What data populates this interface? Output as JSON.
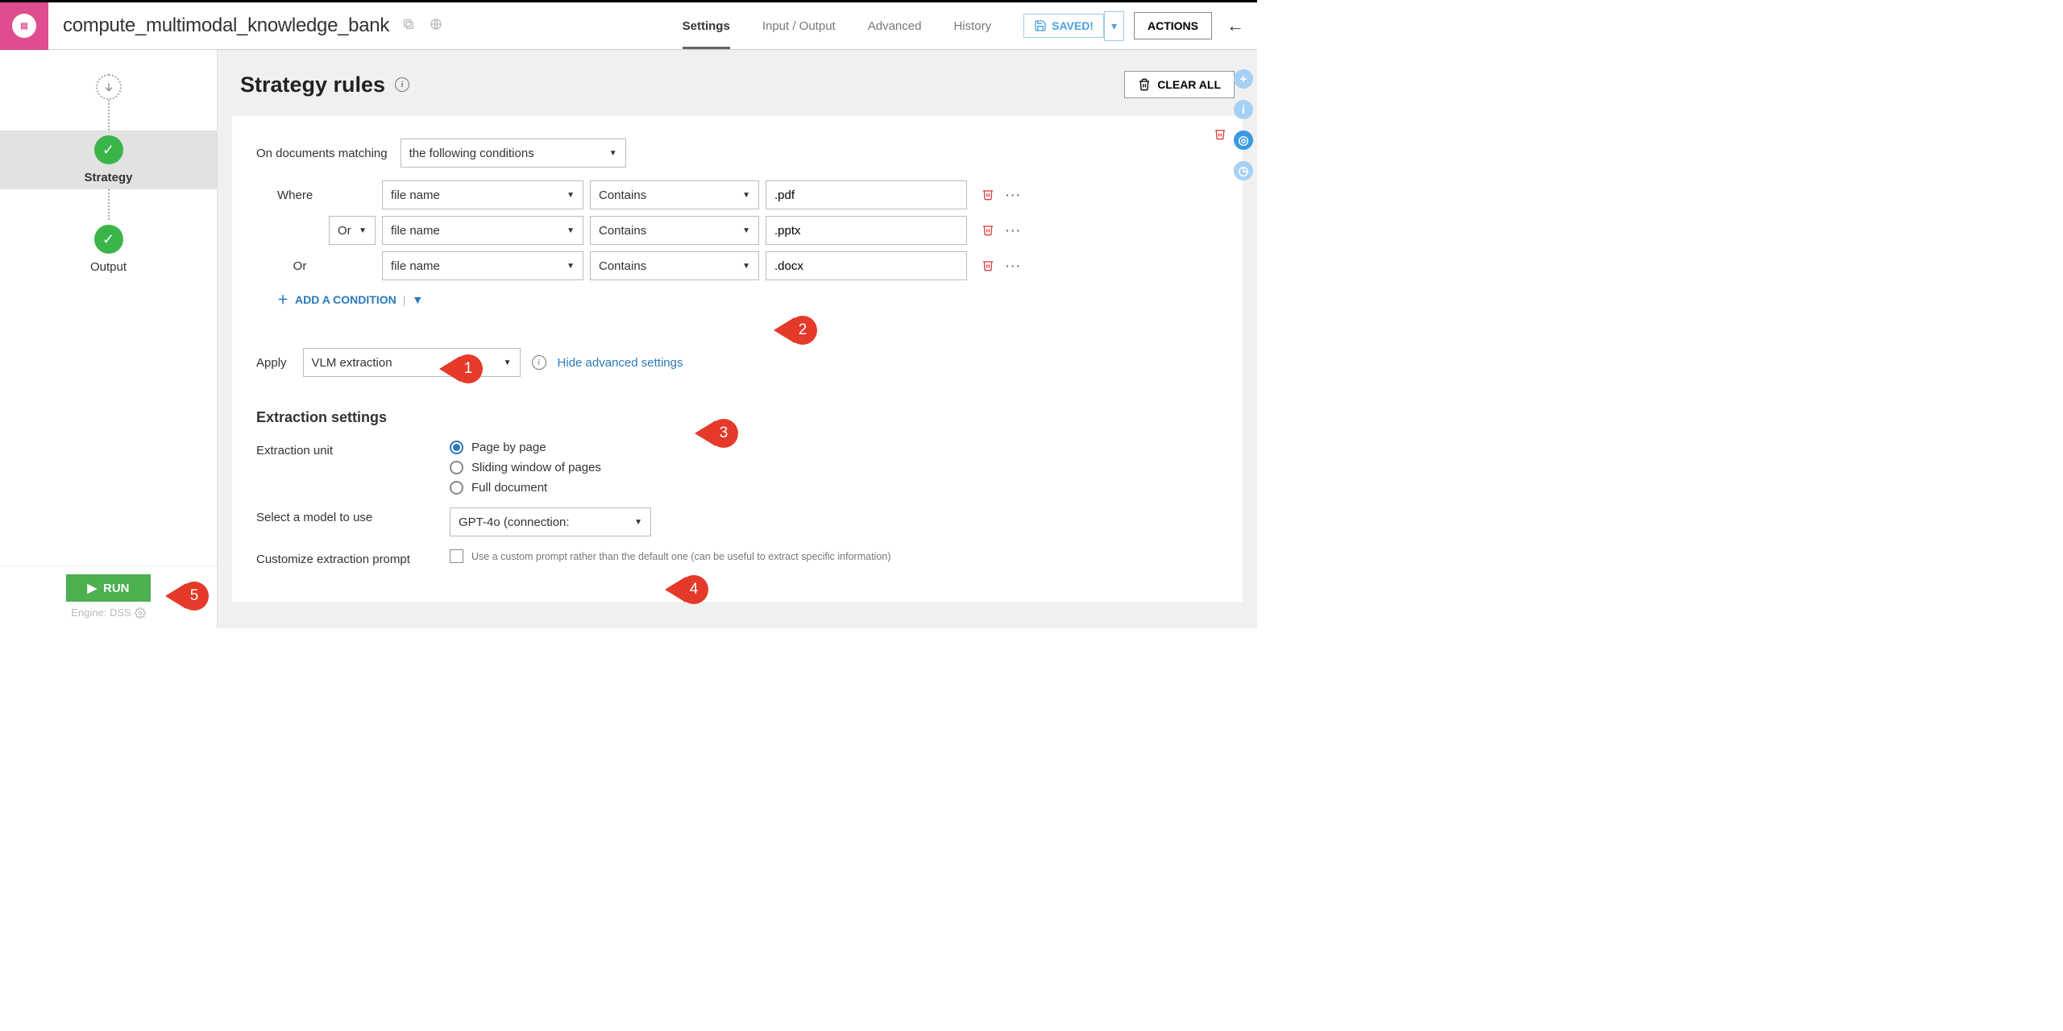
{
  "top": {
    "title": "compute_multimodal_knowledge_bank",
    "tabs": [
      "Settings",
      "Input / Output",
      "Advanced",
      "History"
    ],
    "active_tab": "Settings",
    "saved_label": "SAVED!",
    "actions_label": "ACTIONS"
  },
  "flow": {
    "nodes": [
      {
        "label": "Strategy"
      },
      {
        "label": "Output"
      }
    ]
  },
  "sidebar_footer": {
    "run_label": "RUN",
    "engine_label": "Engine: DSS"
  },
  "page": {
    "heading": "Strategy rules",
    "clear_all": "CLEAR ALL"
  },
  "rule": {
    "matching_label": "On documents matching",
    "matching_mode": "the following conditions",
    "where_label": "Where",
    "conditions": [
      {
        "joiner": "",
        "field": "file name",
        "op": "Contains",
        "value": ".pdf"
      },
      {
        "joiner": "Or",
        "field": "file name",
        "op": "Contains",
        "value": ".pptx"
      },
      {
        "joiner": "Or",
        "field": "file name",
        "op": "Contains",
        "value": ".docx"
      }
    ],
    "add_condition_label": "ADD A CONDITION",
    "apply_label": "Apply",
    "apply_value": "VLM extraction",
    "hide_advanced": "Hide advanced settings",
    "extraction_heading": "Extraction settings",
    "extraction_unit_label": "Extraction unit",
    "extraction_unit_options": [
      "Page by page",
      "Sliding window of pages",
      "Full document"
    ],
    "extraction_unit_selected": "Page by page",
    "model_label": "Select a model to use",
    "model_value": "GPT-4o (connection:",
    "customize_label": "Customize extraction prompt",
    "customize_hint": "Use a custom prompt rather than the default one (can be useful to extract specific information)"
  },
  "callouts": [
    "1",
    "2",
    "3",
    "4",
    "5"
  ]
}
